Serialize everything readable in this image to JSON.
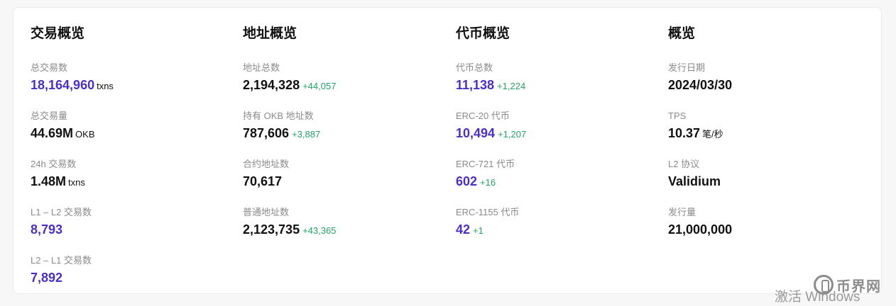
{
  "columns": [
    {
      "title": "交易概览",
      "items": [
        {
          "label": "总交易数",
          "value": "18,164,960",
          "unit": "txns",
          "delta": "",
          "color": "purple"
        },
        {
          "label": "总交易量",
          "value": "44.69M",
          "unit": "OKB",
          "delta": "",
          "color": "dark"
        },
        {
          "label": "24h 交易数",
          "value": "1.48M",
          "unit": "txns",
          "delta": "",
          "color": "dark"
        },
        {
          "label": "L1 – L2 交易数",
          "value": "8,793",
          "unit": "",
          "delta": "",
          "color": "purple"
        },
        {
          "label": "L2 – L1 交易数",
          "value": "7,892",
          "unit": "",
          "delta": "",
          "color": "purple"
        }
      ]
    },
    {
      "title": "地址概览",
      "items": [
        {
          "label": "地址总数",
          "value": "2,194,328",
          "unit": "",
          "delta": "+44,057",
          "color": "dark"
        },
        {
          "label": "持有 OKB 地址数",
          "value": "787,606",
          "unit": "",
          "delta": "+3,887",
          "color": "dark"
        },
        {
          "label": "合约地址数",
          "value": "70,617",
          "unit": "",
          "delta": "",
          "color": "dark"
        },
        {
          "label": "普通地址数",
          "value": "2,123,735",
          "unit": "",
          "delta": "+43,365",
          "color": "dark"
        }
      ]
    },
    {
      "title": "代币概览",
      "items": [
        {
          "label": "代币总数",
          "value": "11,138",
          "unit": "",
          "delta": "+1,224",
          "color": "purple"
        },
        {
          "label": "ERC-20 代币",
          "value": "10,494",
          "unit": "",
          "delta": "+1,207",
          "color": "purple"
        },
        {
          "label": "ERC-721 代币",
          "value": "602",
          "unit": "",
          "delta": "+16",
          "color": "purple"
        },
        {
          "label": "ERC-1155 代币",
          "value": "42",
          "unit": "",
          "delta": "+1",
          "color": "purple"
        }
      ]
    },
    {
      "title": "概览",
      "items": [
        {
          "label": "发行日期",
          "value": "2024/03/30",
          "unit": "",
          "delta": "",
          "color": "dark"
        },
        {
          "label": "TPS",
          "value": "10.37",
          "unit": "笔/秒",
          "delta": "",
          "color": "dark"
        },
        {
          "label": "L2 协议",
          "value": "Validium",
          "unit": "",
          "delta": "",
          "color": "dark"
        },
        {
          "label": "发行量",
          "value": "21,000,000",
          "unit": "",
          "delta": "",
          "color": "dark"
        }
      ]
    }
  ],
  "watermark": "激活 Windows",
  "brand": {
    "name": "币界网"
  },
  "colors": {
    "purple": "#4b2fc9",
    "green": "#22a365",
    "label": "#8a8a8a"
  }
}
